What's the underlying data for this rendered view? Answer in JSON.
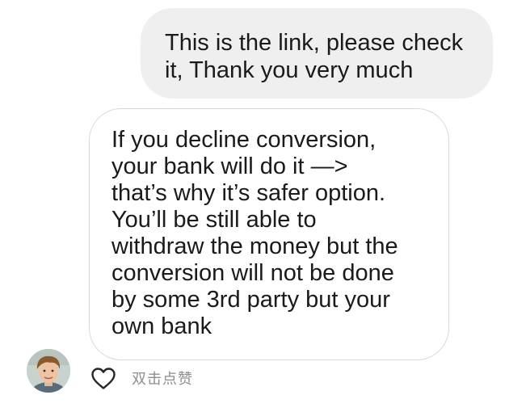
{
  "conversation": {
    "outgoing_message": {
      "lines": [
        "This is the link, please check",
        "it, Thank you very much"
      ]
    },
    "incoming_message": {
      "lines": [
        "If you decline conversion,",
        "your bank will do it —>",
        "that’s why it’s safer option.",
        "You’ll be still able to",
        "withdraw the money but the",
        "conversion will not be done",
        "by some 3rd party but your",
        "own bank"
      ]
    },
    "sender": {
      "avatar_icon": "user-avatar-photo"
    },
    "reaction": {
      "like_icon": "heart-outline-icon",
      "hint": "双击点赞"
    }
  },
  "colors": {
    "outgoing_bubble": "#efefef",
    "incoming_bubble_border": "#d9d9d9",
    "text": "#1a1a1a",
    "hint_text": "#8e8e8e"
  }
}
